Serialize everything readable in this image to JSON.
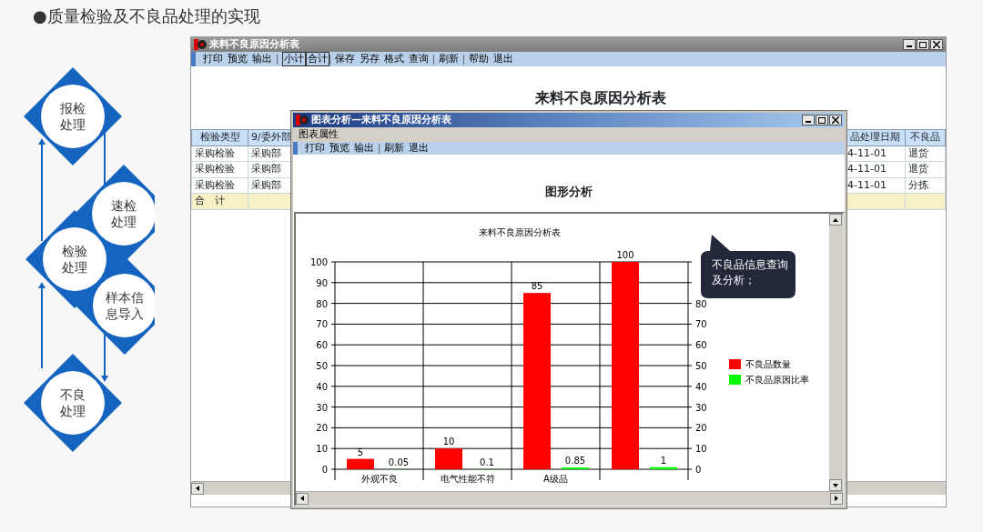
{
  "slide": {
    "title": "●质量检验及不良品处理的实现"
  },
  "flow": {
    "nodes": [
      {
        "lines": [
          "报检",
          "处理"
        ]
      },
      {
        "lines": [
          "速检",
          "处理"
        ]
      },
      {
        "lines": [
          "检验",
          "处理"
        ]
      },
      {
        "lines": [
          "样本信",
          "息导入"
        ]
      },
      {
        "lines": [
          "不良",
          "处理"
        ]
      }
    ]
  },
  "back_window": {
    "title": "来料不良原因分析表",
    "toolbar": [
      {
        "kind": "button",
        "label": "打印"
      },
      {
        "kind": "button",
        "label": "预览"
      },
      {
        "kind": "button",
        "label": "输出"
      },
      {
        "kind": "separator"
      },
      {
        "kind": "boxed",
        "label": "小计"
      },
      {
        "kind": "boxed",
        "label": "合计"
      },
      {
        "kind": "separator"
      },
      {
        "kind": "button",
        "label": "保存"
      },
      {
        "kind": "button",
        "label": "另存"
      },
      {
        "kind": "button",
        "label": "格式"
      },
      {
        "kind": "button",
        "label": "查询"
      },
      {
        "kind": "separator"
      },
      {
        "kind": "button",
        "label": "刷新"
      },
      {
        "kind": "separator"
      },
      {
        "kind": "button",
        "label": "帮助"
      },
      {
        "kind": "button",
        "label": "退出"
      }
    ],
    "report_title": "来料不良原因分析表",
    "table": {
      "left_columns": [
        "检验类型",
        "9/委外部"
      ],
      "right_columns": [
        "品处理日期",
        "不良品"
      ],
      "rows": [
        {
          "left": [
            "采购检验",
            "采购部"
          ],
          "right": [
            "4-11-01",
            "退货"
          ]
        },
        {
          "left": [
            "采购检验",
            "采购部"
          ],
          "right": [
            "4-11-01",
            "退货"
          ]
        },
        {
          "left": [
            "采购检验",
            "采购部"
          ],
          "right": [
            "4-11-01",
            "分拣"
          ]
        }
      ],
      "total_label": "合　计"
    }
  },
  "front_window": {
    "title": "图表分析—来料不良原因分析表",
    "menu": [
      "图表属性"
    ],
    "toolbar": [
      {
        "kind": "button",
        "label": "打印"
      },
      {
        "kind": "button",
        "label": "预览"
      },
      {
        "kind": "button",
        "label": "输出"
      },
      {
        "kind": "separator"
      },
      {
        "kind": "button",
        "label": "刷新"
      },
      {
        "kind": "button",
        "label": "退出"
      }
    ],
    "heading": "图形分析",
    "chart_data": {
      "type": "bar",
      "title": "来料不良原因分析表",
      "categories": [
        "外观不良",
        "电气性能不符",
        "A级品",
        null
      ],
      "series": [
        {
          "name": "不良品数量",
          "color": "#ff0000",
          "values": [
            5,
            10,
            85,
            100
          ]
        },
        {
          "name": "不良品原因比率",
          "color": "#00ff00",
          "values": [
            0.05,
            0.1,
            0.85,
            1
          ]
        }
      ],
      "ylim": [
        0,
        100
      ],
      "yticks": [
        0,
        10,
        20,
        30,
        40,
        50,
        60,
        70,
        80,
        90,
        100
      ],
      "grid": true,
      "legend": true,
      "data_labels": true
    },
    "right_axis_labels": [
      "80",
      "70",
      "60",
      "50",
      "40",
      "30",
      "20",
      "10",
      "0"
    ]
  },
  "callout": {
    "text": "不良品信息查询及分析；"
  }
}
